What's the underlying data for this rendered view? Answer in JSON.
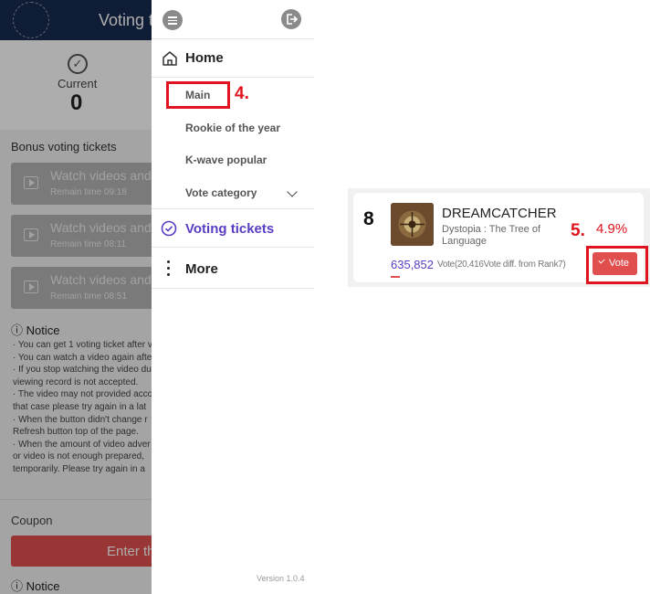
{
  "background_page": {
    "header_title": "Voting t",
    "current_label": "Current",
    "current_value": "0",
    "bonus_title": "Bonus voting tickets",
    "videos": [
      {
        "title": "Watch videos and",
        "remain": "Remain time 09:18"
      },
      {
        "title": "Watch videos and",
        "remain": "Remain time 08:11"
      },
      {
        "title": "Watch videos and",
        "remain": "Remain time 08:51"
      }
    ],
    "notice_title": "Notice",
    "notice_lines": [
      "· You can get 1 voting ticket after v",
      "· You can watch a video again afte",
      "· If you stop watching the video du",
      "  viewing record is not accepted.",
      "· The video may not provided acco",
      "  that case please try again in a lat",
      "· When the button didn't change r",
      "  Refresh button top of the page.",
      "· When the amount of video adver",
      "  or video is not enough prepared,",
      "  temporarily. Please try again in a"
    ],
    "coupon_label": "Coupon",
    "enter_button": "Enter th",
    "notice2_title": "Notice"
  },
  "drawer": {
    "home_label": "Home",
    "sub_items": [
      "Main",
      "Rookie of the year",
      "K-wave popular",
      "Vote category"
    ],
    "voting_tickets_label": "Voting tickets",
    "more_label": "More",
    "version": "Version 1.0.4"
  },
  "annotations": {
    "step4": "4.",
    "step5": "5."
  },
  "vote_card": {
    "rank": "8",
    "artist": "DREAMCATCHER",
    "album": "Dystopia : The Tree of Language",
    "percent": "4.9%",
    "votes": "635,852",
    "votes_detail": "Vote(20,416Vote diff. from Rank7)",
    "progress_fraction": 0.049,
    "vote_button": "Vote"
  },
  "colors": {
    "accent_red": "#e14e4e",
    "highlight_red": "#e0141e",
    "purple": "#5b3cc4",
    "header_navy": "#172a4f"
  }
}
